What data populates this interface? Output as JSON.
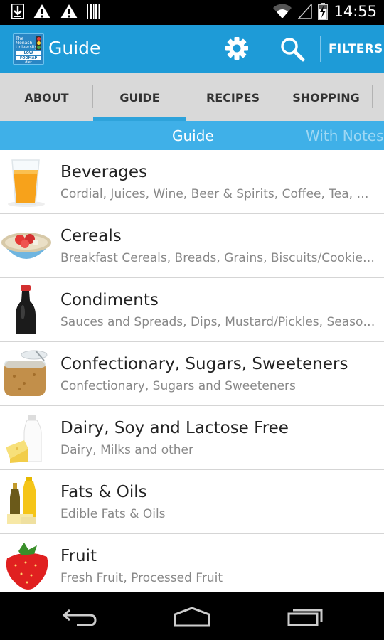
{
  "status_bar": {
    "time": "14:55",
    "icons": [
      "download-icon",
      "warning-icon",
      "warning-icon",
      "barcode-icon",
      "wifi-icon",
      "signal-icon",
      "battery-icon"
    ]
  },
  "action_bar": {
    "logo_text": [
      "The",
      "Monash",
      "University",
      "LOW",
      "FODMAP",
      "diet"
    ],
    "title": "Guide",
    "filters_label": "FILTERS",
    "color": "#1E9BD7"
  },
  "tabs": [
    {
      "label": "ABOUT"
    },
    {
      "label": "GUIDE"
    },
    {
      "label": "RECIPES"
    },
    {
      "label": "SHOPPING"
    }
  ],
  "active_tab": "GUIDE",
  "subbar": {
    "guide_label": "Guide",
    "notes_label": "With Notes"
  },
  "categories": [
    {
      "title": "Beverages",
      "subtitle": "Cordial, Juices, Wine, Beer & Spirits, Coffee, Tea, Milk, Soft Drinks",
      "icon": "orange-juice-icon"
    },
    {
      "title": "Cereals",
      "subtitle": "Breakfast Cereals, Breads, Grains, Biscuits/Cookies, Pasta",
      "icon": "cereal-bowl-icon"
    },
    {
      "title": "Condiments",
      "subtitle": "Sauces and Spreads, Dips, Mustard/Pickles, Seasonings",
      "icon": "soy-sauce-icon"
    },
    {
      "title": "Confectionary, Sugars, Sweeteners",
      "subtitle": "Confectionary, Sugars and Sweeteners",
      "icon": "sugar-jar-icon"
    },
    {
      "title": "Dairy, Soy and Lactose Free",
      "subtitle": "Dairy, Milks and other",
      "icon": "dairy-icon"
    },
    {
      "title": "Fats & Oils",
      "subtitle": "Edible Fats & Oils",
      "icon": "oil-bottles-icon"
    },
    {
      "title": "Fruit",
      "subtitle": "Fresh Fruit, Processed Fruit",
      "icon": "strawberry-icon"
    }
  ]
}
